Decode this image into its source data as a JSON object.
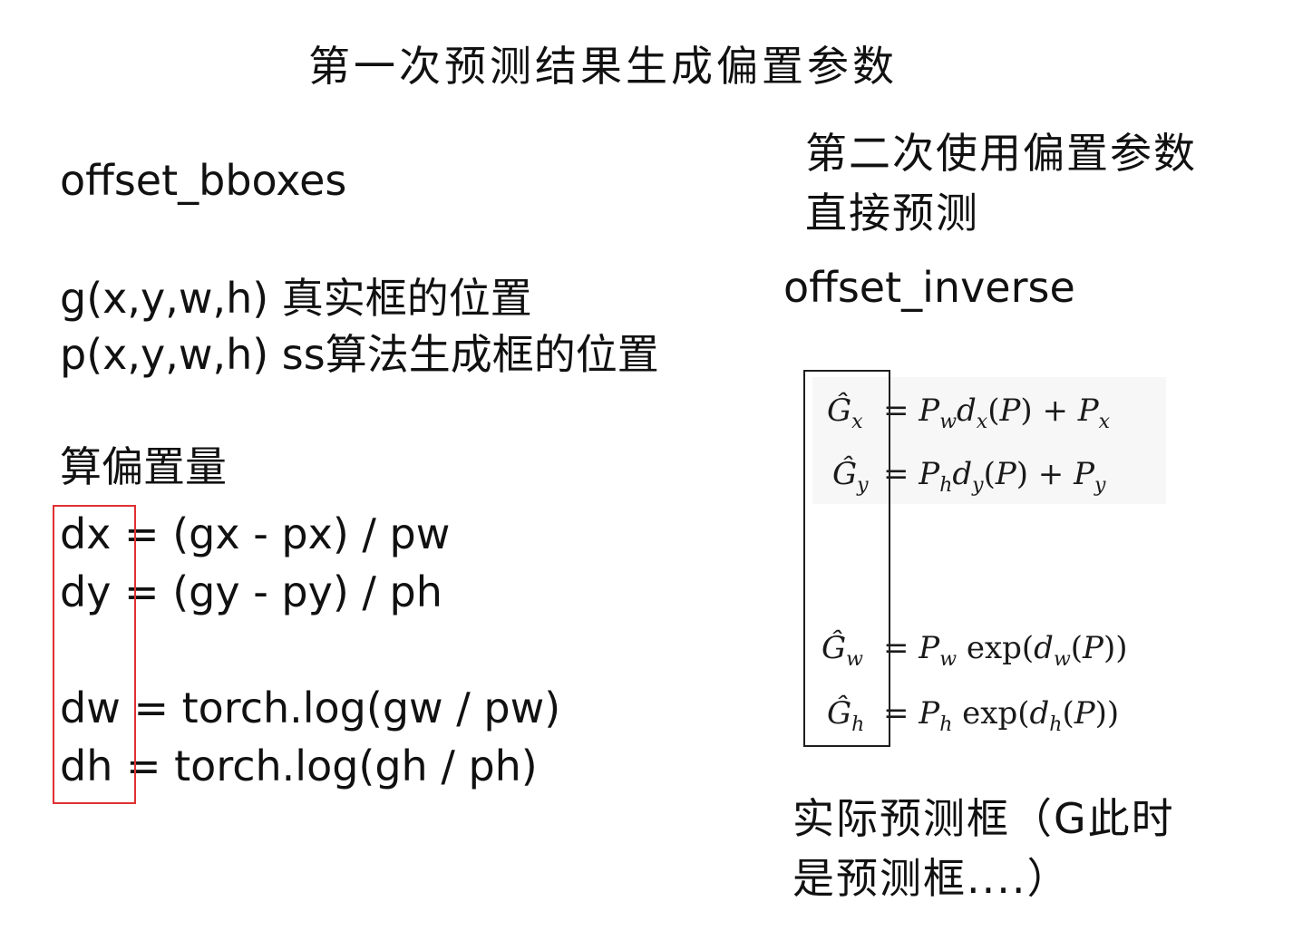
{
  "title": "第一次预测结果生成偏置参数",
  "left": {
    "fn_name": "offset_bboxes",
    "g_line": "g(x,y,w,h) 真实框的位置",
    "p_line": "p(x,y,w,h) ss算法生成框的位置",
    "section": "算偏置量",
    "dx": "dx = (gx - px) / pw",
    "dy": "dy = (gy - py) / ph",
    "dw": "dw = torch.log(gw / pw)",
    "dh": "dh = torch.log(gh / ph)"
  },
  "right": {
    "heading_line1": "第二次使用偏置参数",
    "heading_line2": "直接预测",
    "fn_name": "offset_inverse",
    "formulas": [
      {
        "lhs": "Ĝ",
        "lhs_sub": "x",
        "rhs": "= P_w d_x(P) + P_x"
      },
      {
        "lhs": "Ĝ",
        "lhs_sub": "y",
        "rhs": "= P_h d_y(P) + P_y"
      },
      {
        "lhs": "Ĝ",
        "lhs_sub": "w",
        "rhs": "= P_w exp(d_w(P))"
      },
      {
        "lhs": "Ĝ",
        "lhs_sub": "h",
        "rhs": "= P_h exp(d_h(P))"
      }
    ],
    "note_line1": "实际预测框（G此时",
    "note_line2": "是预测框....）"
  },
  "colors": {
    "red_box": "#e03131",
    "black_box": "#1e1e1e",
    "formula_bg": "#f7f7f7"
  }
}
